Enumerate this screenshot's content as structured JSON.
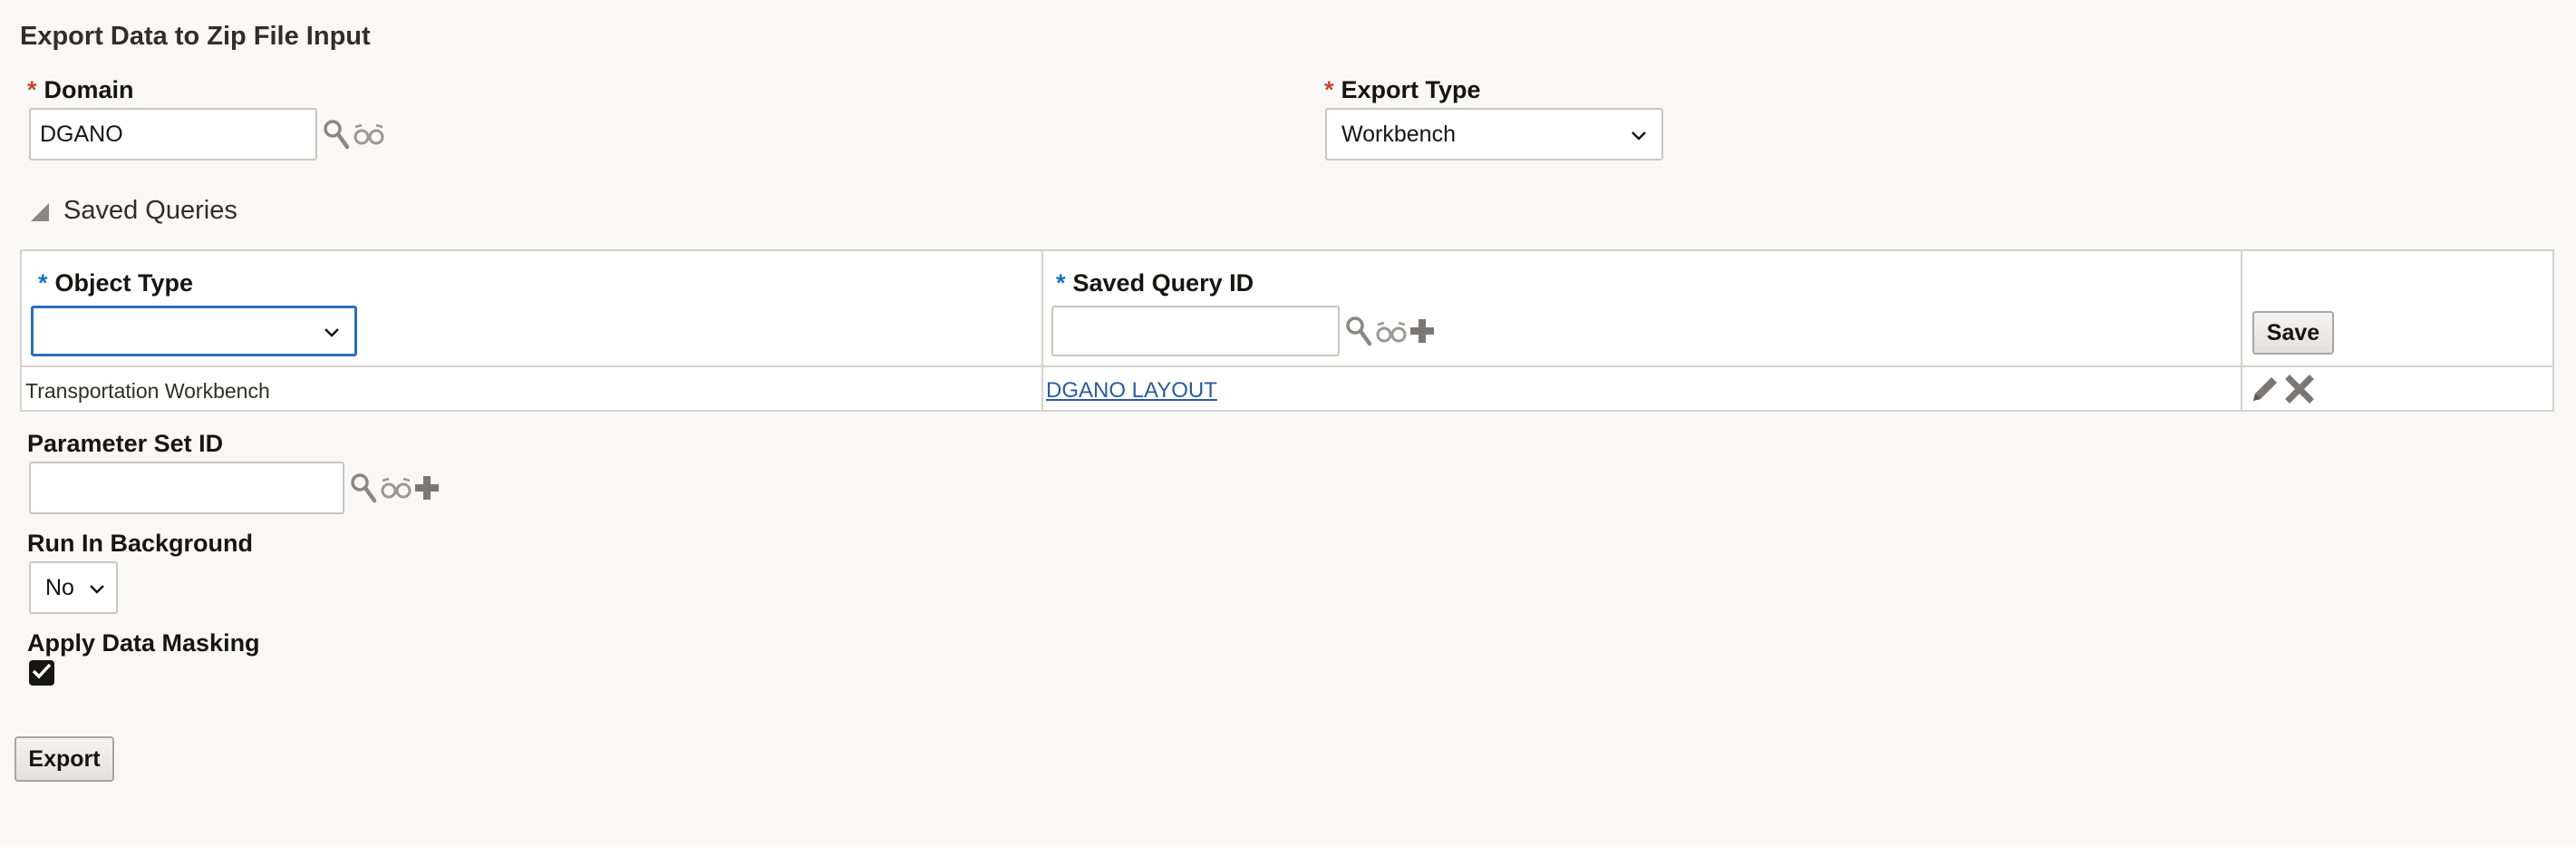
{
  "page": {
    "title": "Export Data to Zip File Input"
  },
  "domain": {
    "label": "Domain",
    "required_mark": "*",
    "value": "DGANO"
  },
  "export_type": {
    "label": "Export Type",
    "required_mark": "*",
    "selected": "Workbench"
  },
  "saved_queries": {
    "section_title": "Saved Queries",
    "columns": [
      {
        "label": "Object Type",
        "required_mark": "*"
      },
      {
        "label": "Saved Query ID",
        "required_mark": "*"
      }
    ],
    "new_row": {
      "object_type": "",
      "saved_query_id": ""
    },
    "save_label": "Save",
    "rows": [
      {
        "object_type": "Transportation Workbench",
        "saved_query_id": "DGANO LAYOUT"
      }
    ]
  },
  "parameter_set": {
    "label": "Parameter Set ID",
    "value": ""
  },
  "run_in_background": {
    "label": "Run In Background",
    "selected": "No"
  },
  "apply_data_masking": {
    "label": "Apply Data Masking",
    "checked": true
  },
  "export_button": {
    "label": "Export"
  },
  "colors": {
    "required_red": "#c74634",
    "required_blue": "#1a73b8",
    "link": "#2a5d9c",
    "focus": "#2f6eb5"
  }
}
